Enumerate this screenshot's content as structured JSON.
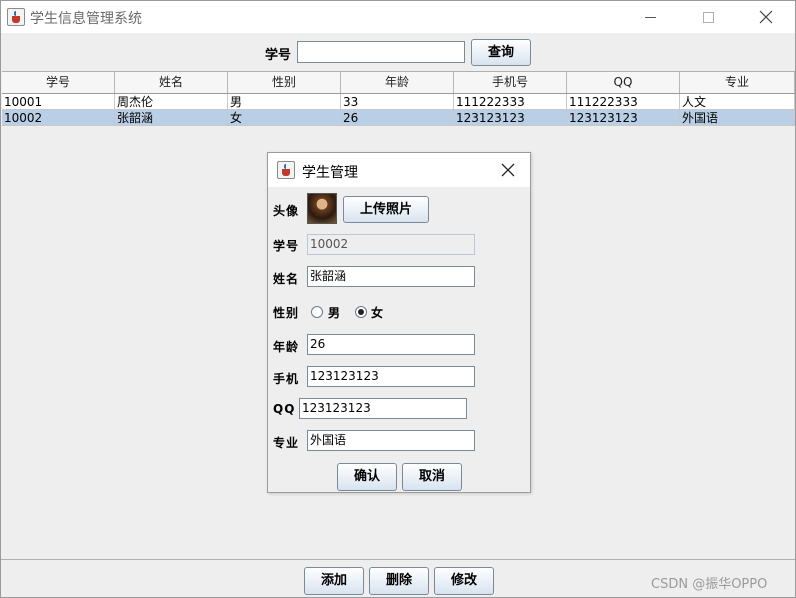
{
  "window": {
    "title": "学生信息管理系统",
    "icon": "java-cup-icon"
  },
  "search": {
    "label": "学号",
    "value": "",
    "button": "查询"
  },
  "table": {
    "headers": [
      "学号",
      "姓名",
      "性别",
      "年龄",
      "手机号",
      "QQ",
      "专业"
    ],
    "rows": [
      [
        "10001",
        "周杰伦",
        "男",
        "33",
        "111222333",
        "111222333",
        "人文"
      ],
      [
        "10002",
        "张韶涵",
        "女",
        "26",
        "123123123",
        "123123123",
        "外国语"
      ]
    ],
    "selected_row": 1
  },
  "dialog": {
    "title": "学生管理",
    "avatar_label": "头像",
    "upload_button": "上传照片",
    "id_label": "学号",
    "id_value": "10002",
    "name_label": "姓名",
    "name_value": "张韶涵",
    "gender_label": "性别",
    "gender_male": "男",
    "gender_female": "女",
    "gender_selected": "女",
    "age_label": "年龄",
    "age_value": "26",
    "phone_label": "手机",
    "phone_value": "123123123",
    "qq_label": "QQ",
    "qq_value": "123123123",
    "major_label": "专业",
    "major_value": "外国语",
    "ok_button": "确认",
    "cancel_button": "取消"
  },
  "bottom": {
    "add_button": "添加",
    "delete_button": "删除",
    "edit_button": "修改"
  },
  "watermark": "CSDN @振华OPPO"
}
